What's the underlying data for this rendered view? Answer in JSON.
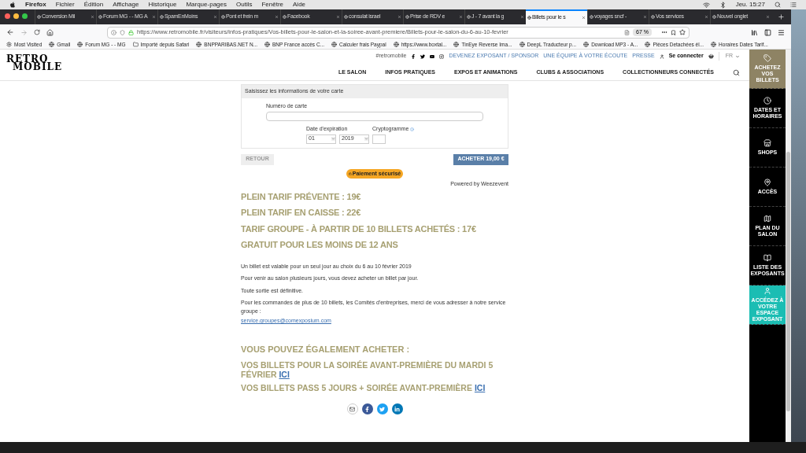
{
  "menubar": {
    "app": "Firefox",
    "menus": [
      "Fichier",
      "Édition",
      "Affichage",
      "Historique",
      "Marque-pages",
      "Outils",
      "Fenêtre",
      "Aide"
    ],
    "clock": "Jeu. 15:27"
  },
  "tabs": [
    {
      "label": "Conversion Mil",
      "selected": false
    },
    {
      "label": "Forum MG - - MG A",
      "selected": false
    },
    {
      "label": "SpamEnMoins",
      "selected": false
    },
    {
      "label": "Pont et frein m",
      "selected": false
    },
    {
      "label": "Facebook",
      "selected": false
    },
    {
      "label": "consulat israel",
      "selected": false
    },
    {
      "label": "Prise de RDV e",
      "selected": false
    },
    {
      "label": "J - 7 avant la g",
      "selected": false
    },
    {
      "label": "Billets pour le s",
      "selected": true
    },
    {
      "label": "voyages sncf -",
      "selected": false
    },
    {
      "label": "Vos services",
      "selected": false
    },
    {
      "label": "Nouvel onglet",
      "selected": false
    }
  ],
  "address_bar": {
    "url": "https://www.retromobile.fr/visiteurs/infos-pratiques/Vos-billets-pour-le-salon-et-la-soiree-avant-premiere/Billets-pour-le-salon-du-6-au-10-fevrier",
    "zoom": "67 %"
  },
  "bookmarks": [
    "Most Visited",
    "Gmail",
    "Forum MG - - MG",
    "Importé depuis Safari",
    "BNPPARIBAS.NET N...",
    "BNP France accès C...",
    "Calculer frais Paypal",
    "https://www.boxtal...",
    "TinEye Reverse Ima...",
    "DeepL Traducteur p...",
    "Download MP3 - A...",
    "Pièces Detachées él...",
    "Horaires Dates Tarif..."
  ],
  "site_header": {
    "logo_top": "RETRO",
    "logo_bottom": "MOBILE",
    "hashtag": "#retromobile",
    "links": [
      "DEVENEZ EXPOSANT / SPONSOR",
      "UNE ÉQUIPE À VOTRE ÉCOUTE",
      "PRESSE"
    ],
    "login": "Se connecter",
    "language": "FR",
    "nav": [
      "LE SALON",
      "INFOS PRATIQUES",
      "EXPOS ET ANIMATIONS",
      "CLUBS & ASSOCIATIONS",
      "COLLECTIONNEURS CONNECTÉS"
    ]
  },
  "side_menu": [
    {
      "label": "ACHETEZ VOS BILLETS",
      "color": "#8e8364"
    },
    {
      "label": "DATES ET HORAIRES",
      "color": "#000000"
    },
    {
      "label": "SHOPS",
      "color": "#000000"
    },
    {
      "label": "ACCÈS",
      "color": "#000000"
    },
    {
      "label": "PLAN DU SALON",
      "color": "#000000"
    },
    {
      "label": "LISTE DES EXPOSANTS",
      "color": "#000000"
    },
    {
      "label": "ACCÉDEZ À VOTRE ESPACE EXPOSANT",
      "color": "#1bbdb3"
    }
  ],
  "payment_form": {
    "title": "Saisissez les informations de votre carte",
    "card_label": "Numéro de carte",
    "expiry_label": "Date d'expiration",
    "month": "01",
    "year": "2019",
    "cvv_label": "Cryptogramme",
    "back": "RETOUR",
    "buy": "ACHETER 19,00 €",
    "secure": "Paiement sécurisé",
    "powered": "Powered by Weezevent"
  },
  "prices": [
    "PLEIN TARIF PRÉVENTE : 19€",
    "PLEIN TARIF EN CAISSE : 22€",
    "TARIF GROUPE - À PARTIR DE 10 BILLETS ACHETÉS : 17€",
    "GRATUIT POUR LES MOINS DE 12 ANS"
  ],
  "notes": [
    "Un billet est valable pour un seul jour au choix du 6 au 10 février 2019",
    "Pour venir au salon plusieurs jours, vous devez acheter un billet par jour.",
    "Toute sortie est définitive.",
    "Pour les commandes de plus de 10 billets, les Comités d'entreprises, merci de vous adresser à notre service groupe :"
  ],
  "email_link": "service.groupes@comexposium.com",
  "also_title": "VOUS POUVEZ ÉGALEMENT ACHETER :",
  "also_items": [
    {
      "text": "VOS BILLETS POUR LA SOIRÉE AVANT-PREMIÈRE DU MARDI 5 FÉVRIER",
      "link": "ICI"
    },
    {
      "text": "VOS BILLETS PASS 5 JOURS + SOIRÉE AVANT-PREMIÈRE",
      "link": "ICI"
    }
  ]
}
